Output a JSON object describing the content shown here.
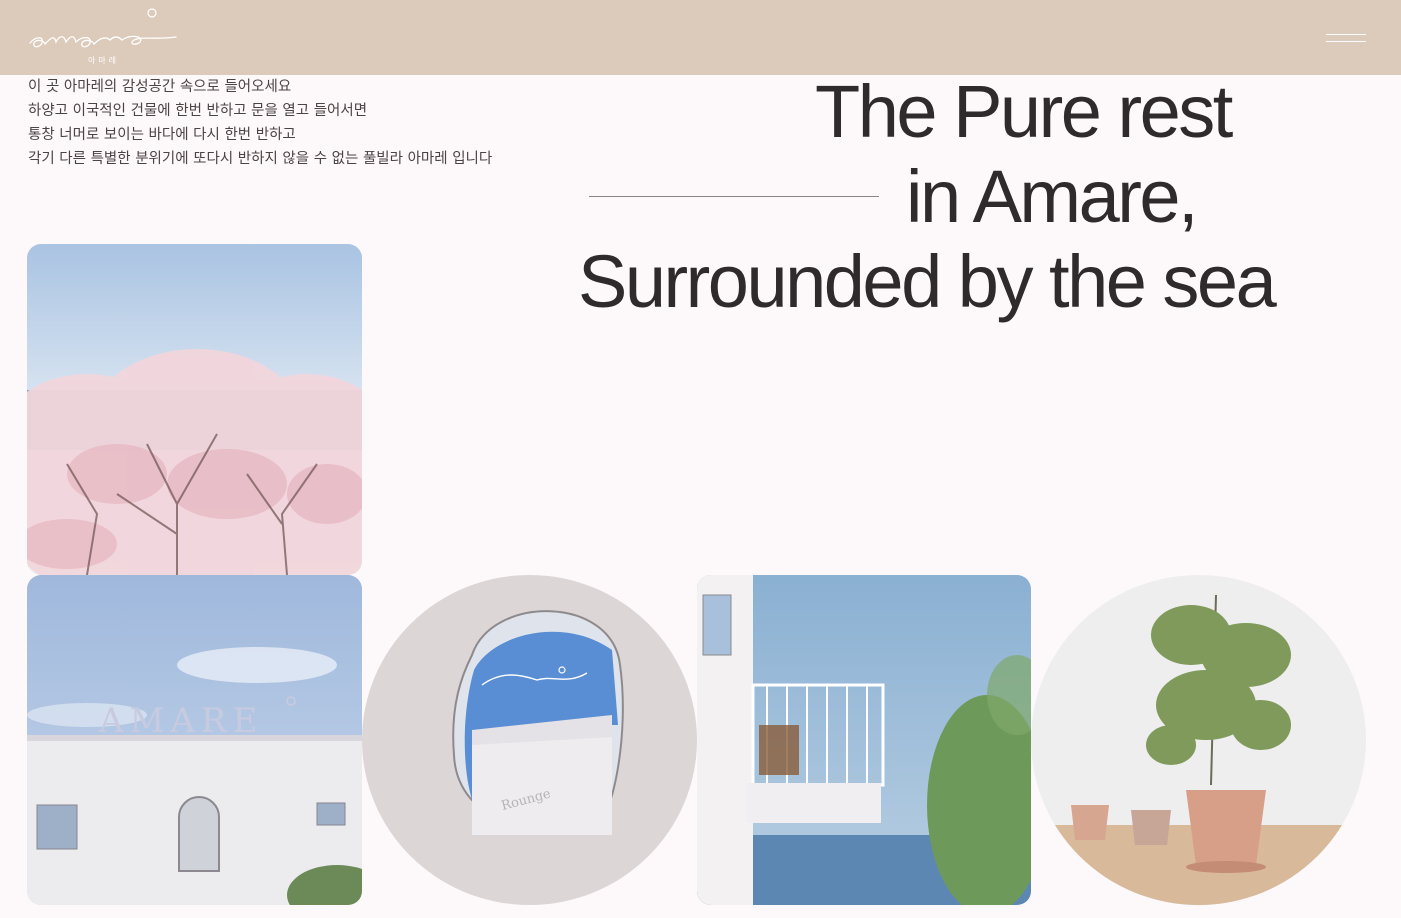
{
  "header": {
    "logo_text": "amare",
    "logo_subtext": "아마레",
    "menu_icon": "hamburger-menu-icon",
    "background_color": "#dccabb"
  },
  "intro": {
    "lines": [
      "이 곳 아마레의 감성공간 속으로 들어오세요",
      "하양고 이국적인 건물에 한번 반하고 문을 열고 들어서면",
      "통창 너머로 보이는 바다에 다시 한번 반하고",
      "각기 다른 특별한 분위기에 또다시 반하지 않을 수 없는 풀빌라 아마레 입니다"
    ]
  },
  "headline": {
    "line1": "The Pure rest",
    "line2": "in Amare,",
    "line3": "Surrounded by the sea"
  },
  "gallery": {
    "building_sign": "AMARE",
    "mirror_logo": "amare",
    "mirror_sign": "Rounge"
  },
  "colors": {
    "page_background": "#fdf9fb",
    "text": "#2f2a2b"
  }
}
